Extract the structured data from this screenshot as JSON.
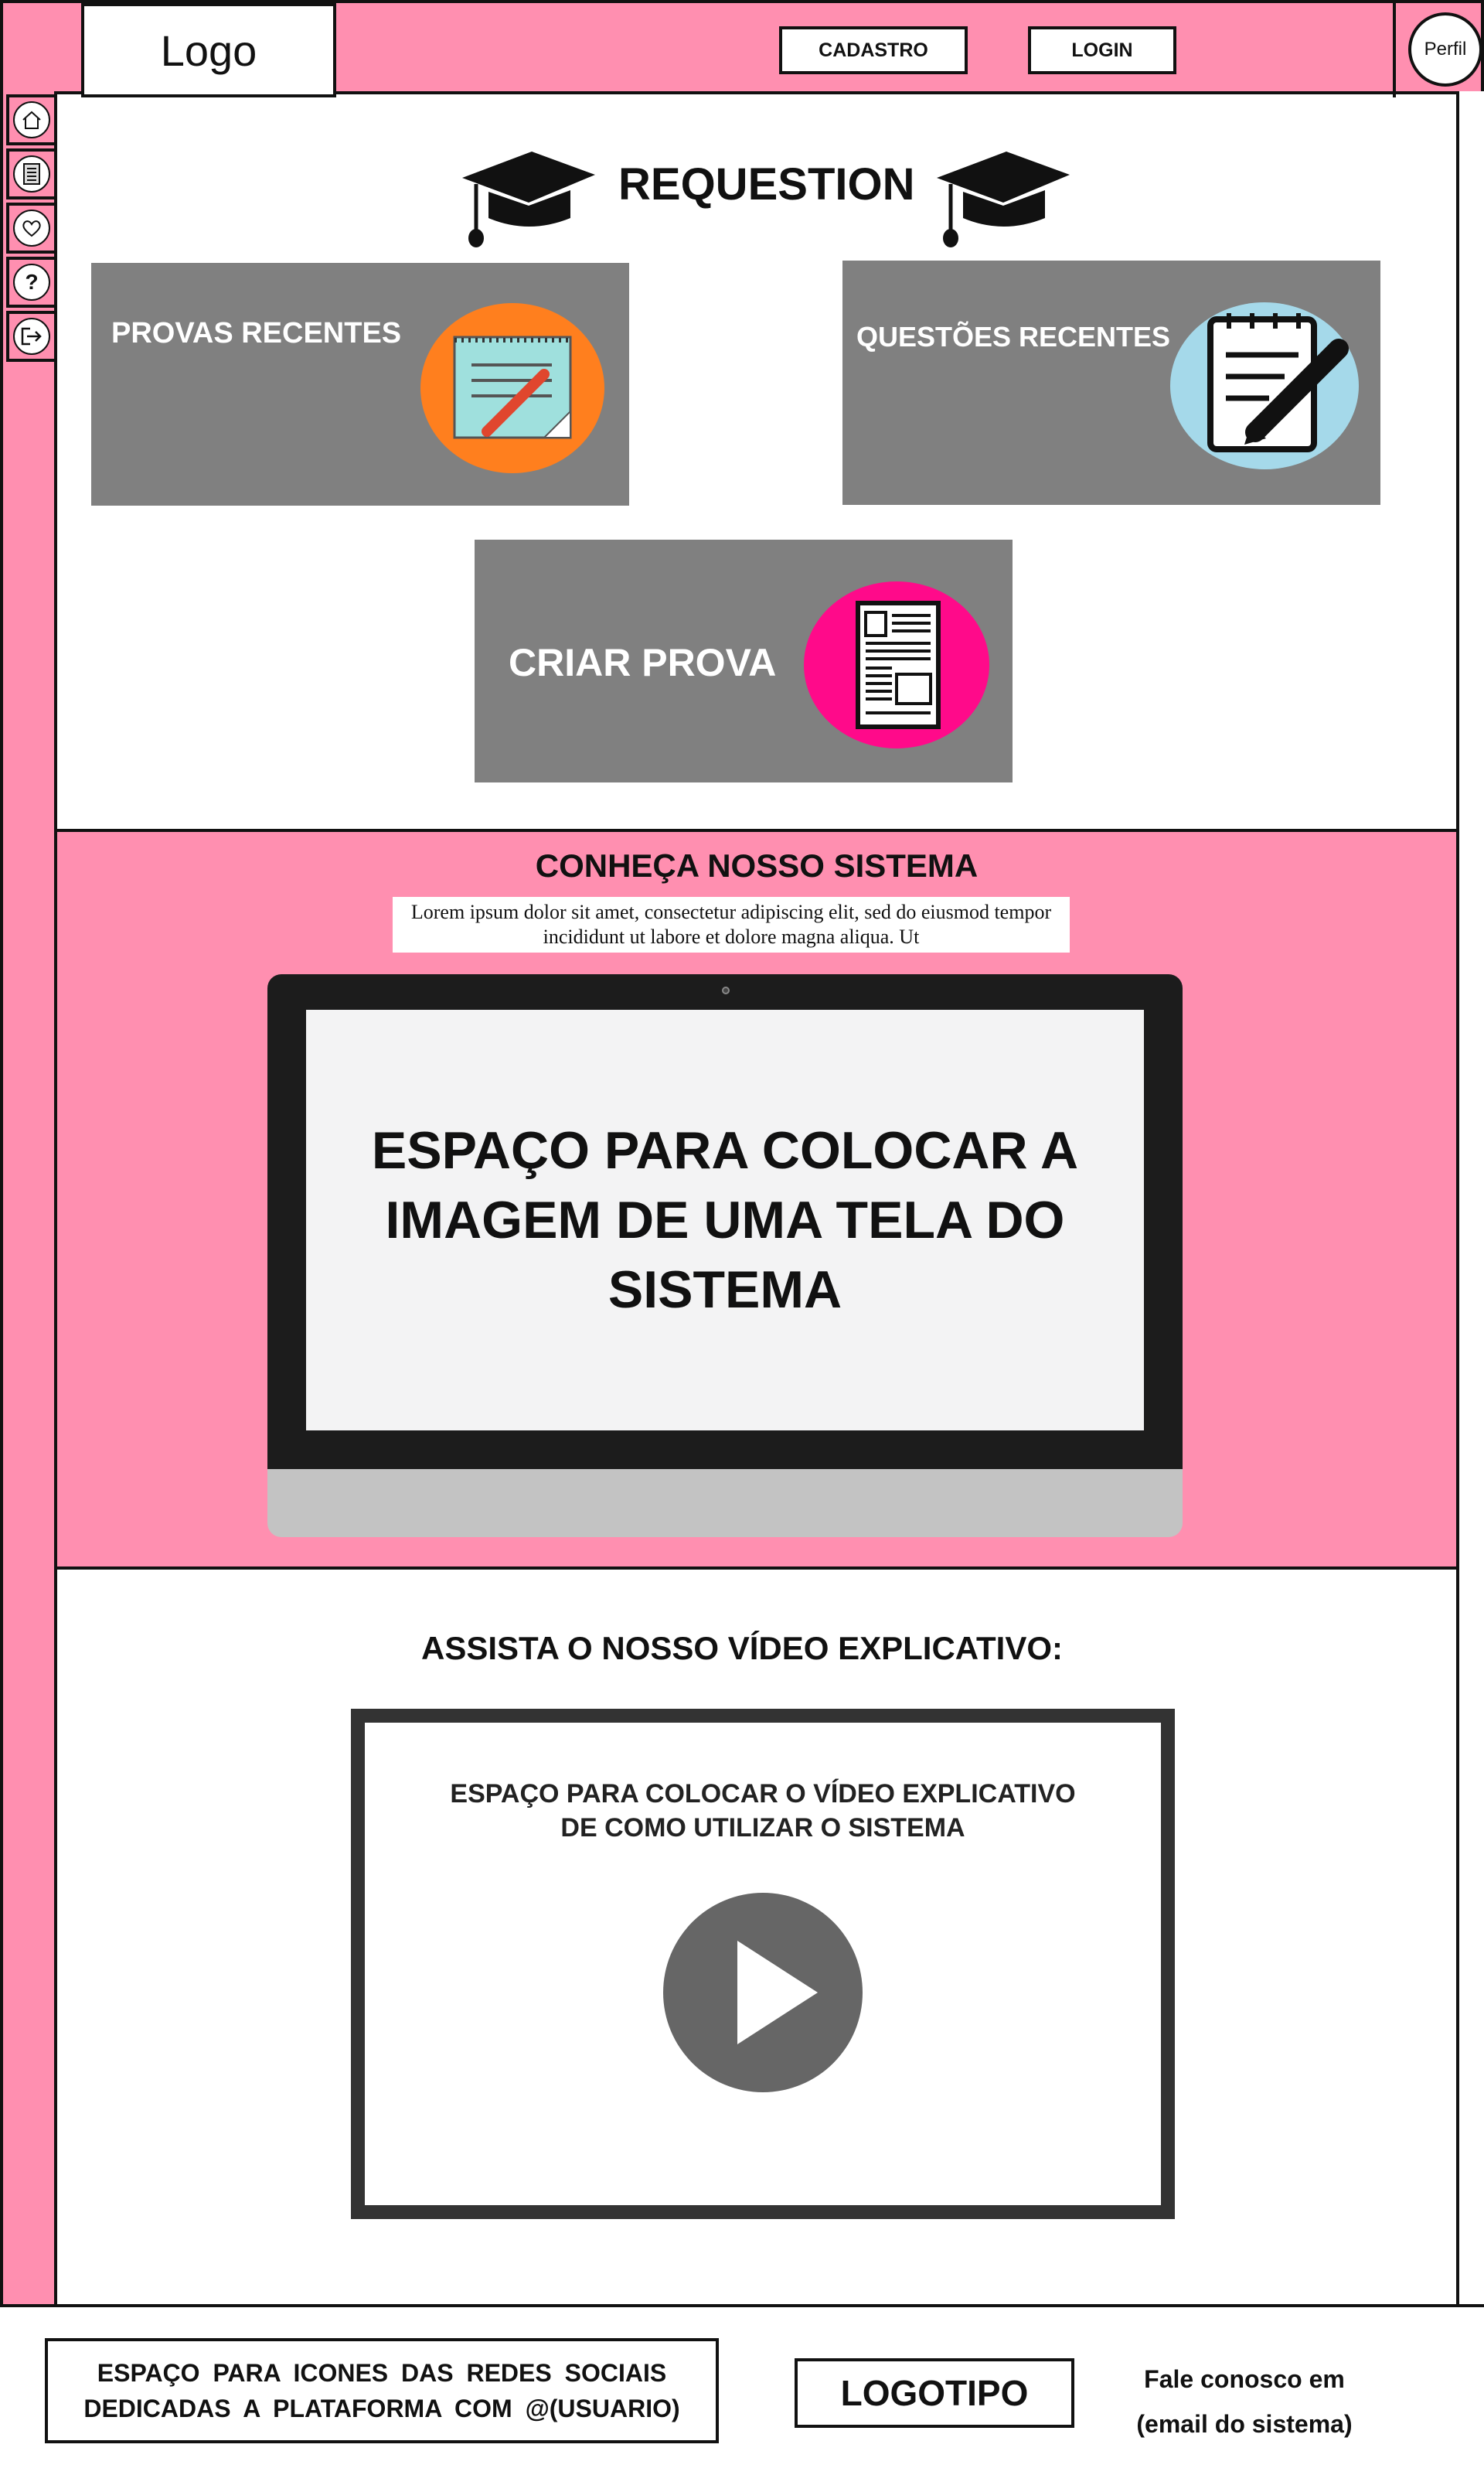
{
  "header": {
    "logo": "Logo",
    "signup_label": "CADASTRO",
    "login_label": "LOGIN",
    "profile_label": "Perfil"
  },
  "sidebar": {
    "items": [
      {
        "icon": "home-icon"
      },
      {
        "icon": "document-icon"
      },
      {
        "icon": "heart-icon"
      },
      {
        "icon": "help-icon",
        "glyph": "?"
      },
      {
        "icon": "logout-icon"
      }
    ]
  },
  "hero": {
    "title": "REQUESTION",
    "cards": [
      {
        "label": "PROVAS RECENTES",
        "icon": "notepad-pencil-icon",
        "circle_color": "#ff7f1e"
      },
      {
        "label": "QUESTÕES RECENTES",
        "icon": "notepad-pen-icon",
        "circle_color": "#a5d9ea"
      },
      {
        "label": "CRIAR PROVA",
        "icon": "newspaper-icon",
        "circle_color": "#ff0a8a"
      }
    ]
  },
  "about": {
    "title": "CONHEÇA NOSSO SISTEMA",
    "lorem": "Lorem ipsum dolor sit amet, consectetur adipiscing elit, sed do eiusmod tempor incididunt ut labore et dolore magna aliqua. Ut",
    "screen_text": "ESPAÇO PARA COLOCAR A IMAGEM DE UMA TELA DO SISTEMA"
  },
  "video": {
    "title": "ASSISTA O NOSSO VÍDEO EXPLICATIVO:",
    "placeholder_line1": "ESPAÇO PARA COLOCAR O VÍDEO EXPLICATIVO",
    "placeholder_line2": "DE COMO UTILIZAR O SISTEMA"
  },
  "footer": {
    "social_line1": "ESPAÇO PARA ICONES DAS REDES SOCIAIS",
    "social_line2": "DEDICADAS A PLATAFORMA COM @(USUARIO)",
    "logo": "LOGOTIPO",
    "contact_line1": "Fale conosco em",
    "contact_line2": "(email do sistema)"
  },
  "colors": {
    "pink": "#ff8fb0",
    "card_gray": "#808080",
    "dark": "#111111"
  }
}
